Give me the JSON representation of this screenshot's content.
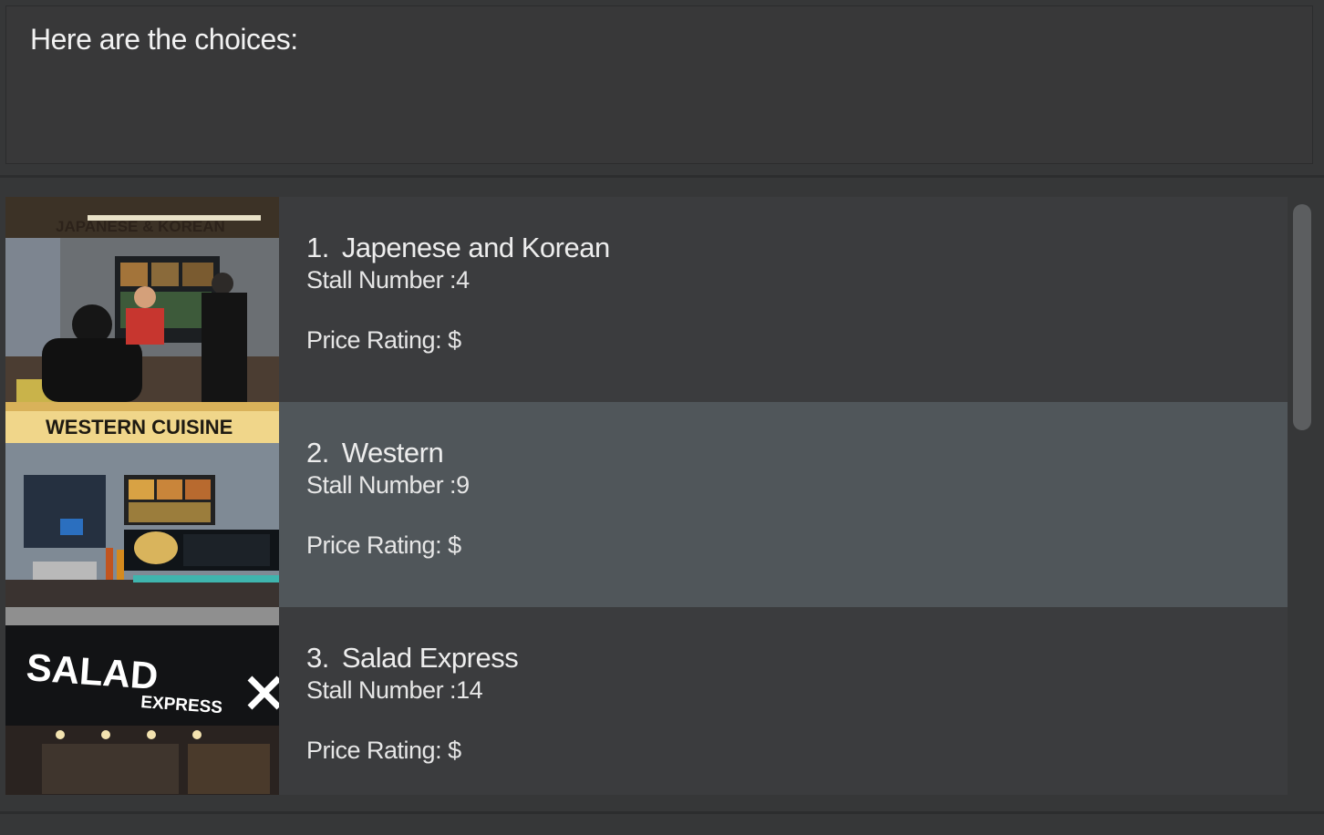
{
  "result": {
    "text": "Here are the choices:"
  },
  "stalls": [
    {
      "index": "1.",
      "name": "Japenese and Korean",
      "stall_label": "Stall Number :",
      "stall_number": "4",
      "price_label": "Price Rating: ",
      "price_rating": "$",
      "sign_text": "JAPANESE & KOREAN"
    },
    {
      "index": "2.",
      "name": "Western",
      "stall_label": "Stall Number :",
      "stall_number": "9",
      "price_label": "Price Rating: ",
      "price_rating": "$",
      "sign_text": "WESTERN CUISINE"
    },
    {
      "index": "3.",
      "name": "Salad Express",
      "stall_label": "Stall Number :",
      "stall_number": "14",
      "price_label": "Price Rating: ",
      "price_rating": "$",
      "sign_text": "SALAD",
      "sign_subtext": "EXPRESS"
    }
  ],
  "selected_index": 1,
  "colors": {
    "background": "#363738",
    "card": "#3b3c3e",
    "card_selected": "#50565a",
    "text": "#ededed"
  }
}
